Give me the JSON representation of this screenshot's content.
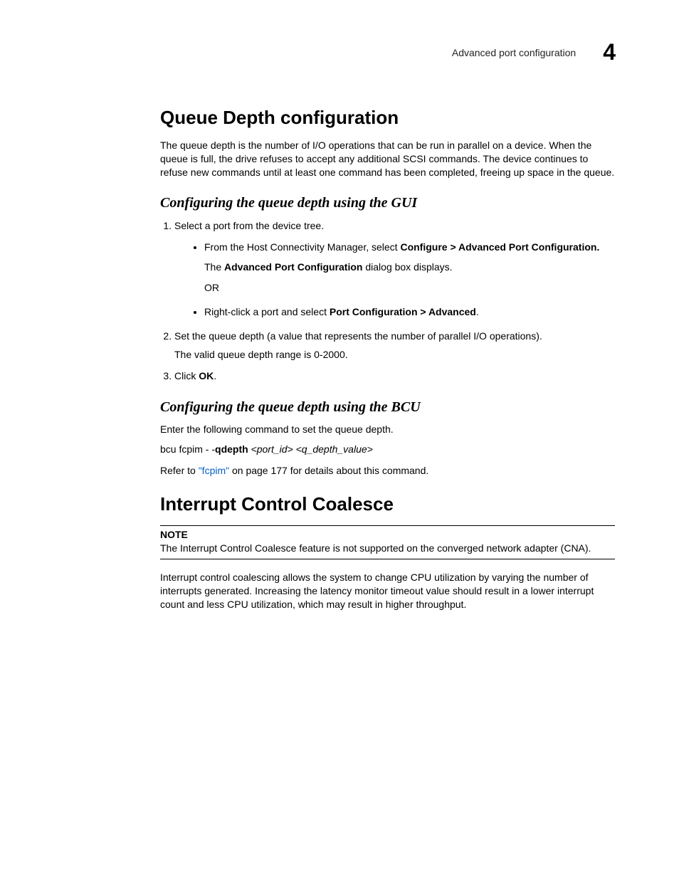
{
  "header": {
    "text": "Advanced port configuration",
    "chapter": "4"
  },
  "section1": {
    "title": "Queue Depth configuration",
    "intro": "The queue depth is the number of I/O operations that can be run in parallel on a device. When the queue is full, the drive refuses to accept any additional SCSI commands. The device continues to refuse new commands until at least one command has been completed, freeing up space in the queue.",
    "gui": {
      "title": "Configuring the queue depth using the GUI",
      "step1": "Select a port from the device tree.",
      "b1_pre": "From the Host Connectivity Manager, select ",
      "b1_bold": "Configure > Advanced Port Configuration.",
      "b1_line2_pre": "The ",
      "b1_line2_bold": "Advanced Port Configuration",
      "b1_line2_post": " dialog box displays.",
      "or": "OR",
      "b2_pre": "Right-click a port and select ",
      "b2_bold": "Port Configuration > Advanced",
      "b2_post": ".",
      "step2": "Set the queue depth (a value that represents the number of parallel I/O operations).",
      "step2b": "The valid queue depth range is 0-2000.",
      "step3_pre": "Click ",
      "step3_bold": "OK",
      "step3_post": "."
    },
    "bcu": {
      "title": "Configuring the queue depth using the BCU",
      "intro": "Enter the following command to set the queue depth.",
      "cmd_pre": "bcu fcpim - -",
      "cmd_bold": "qdepth",
      "cmd_arg": " <port_id> <q_depth_value>",
      "refer_pre": "Refer to ",
      "refer_link": "\"fcpim\"",
      "refer_post": " on page 177 for details about this command."
    }
  },
  "section2": {
    "title": "Interrupt Control Coalesce",
    "note_label": "NOTE",
    "note_body": "The Interrupt Control Coalesce feature is not supported on the converged network adapter (CNA).",
    "body": "Interrupt control coalescing allows the system to change CPU utilization by varying the number of interrupts generated. Increasing the latency monitor timeout value should result in a lower interrupt count and less CPU utilization, which may result in higher throughput."
  }
}
